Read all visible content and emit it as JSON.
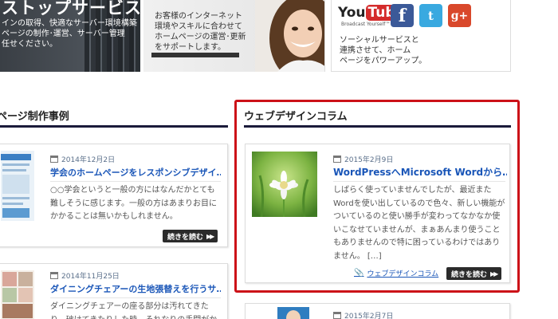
{
  "banners": {
    "server": {
      "heading": "ストップサービス",
      "text": "インの取得、快適なサーバー環境構築\nページの制作･運営、サーバー管理\n任せください。"
    },
    "support": {
      "text": "お客様のインターネット\n環境やスキルに合わせて\nホームページの運営･更新\nをサポートします。"
    },
    "social": {
      "youtube_label": "You",
      "youtube_tube": "Tube",
      "youtube_sub": "Broadcast Yourself™",
      "facebook": "f",
      "twitter": "t",
      "gplus": "g+",
      "text": "ソーシャルサービスと\n連携させて、ホーム\nページをパワーアップ。"
    }
  },
  "sections": {
    "left_title": "ページ制作事例",
    "right_title": "ウェブデザインコラム"
  },
  "left_posts": [
    {
      "date": "2014年12月2日",
      "title": "学会のホームページをレスポンシブデザイ…",
      "excerpt": "○○学会というと一般の方にはなんだかとても難しそうに感じます。一般の方はあまりお目にかかることは無いかもしれません。",
      "more": "続きを読む"
    },
    {
      "date": "2014年11月25日",
      "title": "ダイニングチェアーの生地張替えを行うサ…",
      "excerpt": "ダイニングチェアーの座る部分は汚れてきた り、破けてきたりした時、それなりの手間がか",
      "more": ""
    }
  ],
  "featured_post": {
    "date": "2015年2月9日",
    "title": "WordPressへMicrosoft Wordから…",
    "excerpt": "しばらく使っていませんでしたが、最近またWordを使い出しているので色々、新しい機能がついているのと使い勝手が変わってなかなか使いこなせていませんが、まぁあんまり使うこともありませんので特に困っているわけではありません。 […]",
    "category": "ウェブデザインコラム",
    "more": "続きを読む"
  },
  "next_post": {
    "date": "2015年2月7日"
  },
  "colors": {
    "link": "#1a56b8",
    "highlight": "#cc1118",
    "rule": "#1b1b3a"
  }
}
